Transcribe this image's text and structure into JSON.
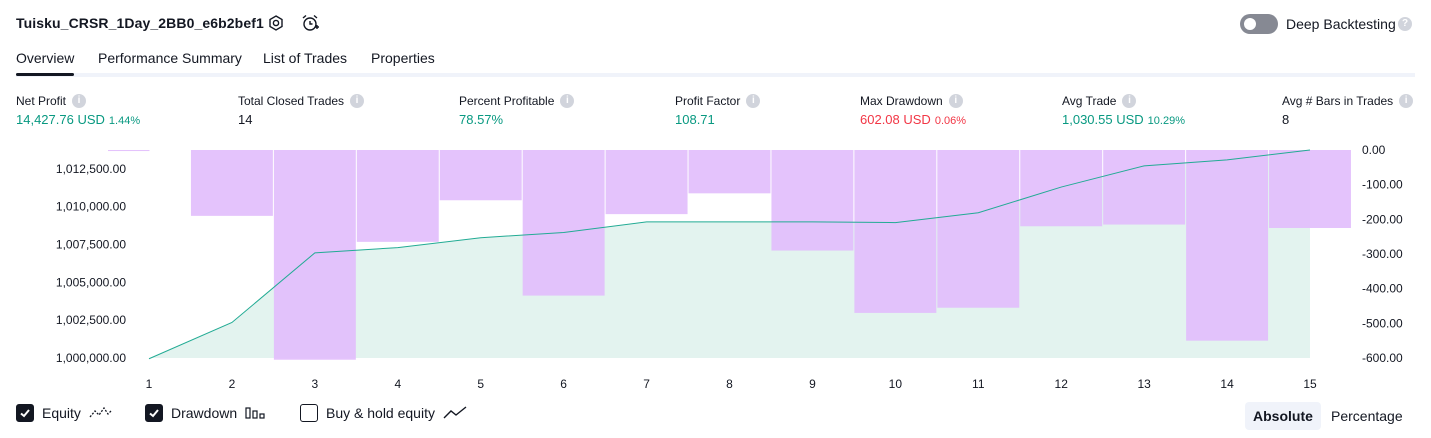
{
  "header": {
    "title": "Tuisku_CRSR_1Day_2BB0_e6b2bef1",
    "deep_backtesting_label": "Deep Backtesting",
    "deep_backtesting_enabled": false,
    "icons": [
      "settings-icon",
      "alarm-add-icon",
      "help-icon"
    ]
  },
  "tabs": [
    {
      "label": "Overview",
      "active": true
    },
    {
      "label": "Performance Summary",
      "active": false
    },
    {
      "label": "List of Trades",
      "active": false
    },
    {
      "label": "Properties",
      "active": false
    }
  ],
  "metrics": [
    {
      "label": "Net Profit",
      "value": "14,427.76 USD",
      "pct": "1.44%",
      "tone": "pos"
    },
    {
      "label": "Total Closed Trades",
      "value": "14",
      "pct": "",
      "tone": "neu"
    },
    {
      "label": "Percent Profitable",
      "value": "78.57%",
      "pct": "",
      "tone": "pos"
    },
    {
      "label": "Profit Factor",
      "value": "108.71",
      "pct": "",
      "tone": "pos"
    },
    {
      "label": "Max Drawdown",
      "value": "602.08 USD",
      "pct": "0.06%",
      "tone": "neg"
    },
    {
      "label": "Avg Trade",
      "value": "1,030.55 USD",
      "pct": "10.29%",
      "tone": "pos"
    },
    {
      "label": "Avg # Bars in Trades",
      "value": "8",
      "pct": "",
      "tone": "neu"
    }
  ],
  "chart_data": {
    "type": "area",
    "x": [
      1,
      2,
      3,
      4,
      5,
      6,
      7,
      8,
      9,
      10,
      11,
      12,
      13,
      14,
      15
    ],
    "series": [
      {
        "name": "Equity",
        "axis": "left",
        "color": "#22ab94",
        "fill": "#e3f3ef",
        "values": [
          999950,
          1002350,
          1006950,
          1007300,
          1007950,
          1008300,
          1009000,
          1009000,
          1009000,
          1008950,
          1009600,
          1011300,
          1012700,
          1013100,
          1013750
        ]
      },
      {
        "name": "Drawdown",
        "type": "bar",
        "axis": "right",
        "color": "#e1bdfc",
        "values": [
          -3,
          -190,
          -605,
          -265,
          -145,
          -420,
          -185,
          -125,
          -290,
          -470,
          -455,
          -220,
          -215,
          -550,
          -225
        ]
      }
    ],
    "left_axis": {
      "min": 1000000,
      "max": 1013750,
      "ticks": [
        "1,000,000.00",
        "1,002,500.00",
        "1,005,000.00",
        "1,007,500.00",
        "1,010,000.00",
        "1,012,500.00"
      ],
      "tick_values": [
        1000000,
        1002500,
        1005000,
        1007500,
        1010000,
        1012500
      ]
    },
    "right_axis": {
      "min": -600,
      "max": 0,
      "ticks": [
        "0.00",
        "-100.00",
        "-200.00",
        "-300.00",
        "-400.00",
        "-500.00",
        "-600.00"
      ],
      "tick_values": [
        0,
        -100,
        -200,
        -300,
        -400,
        -500,
        -600
      ]
    },
    "x_ticks": [
      "1",
      "2",
      "3",
      "4",
      "5",
      "6",
      "7",
      "8",
      "9",
      "10",
      "11",
      "12",
      "13",
      "14",
      "15"
    ],
    "grid": false
  },
  "legend": {
    "items": [
      {
        "label": "Equity",
        "checked": true
      },
      {
        "label": "Drawdown",
        "checked": true
      },
      {
        "label": "Buy & hold equity",
        "checked": false
      }
    ],
    "modes": [
      {
        "label": "Absolute",
        "active": true
      },
      {
        "label": "Percentage",
        "active": false
      }
    ]
  }
}
